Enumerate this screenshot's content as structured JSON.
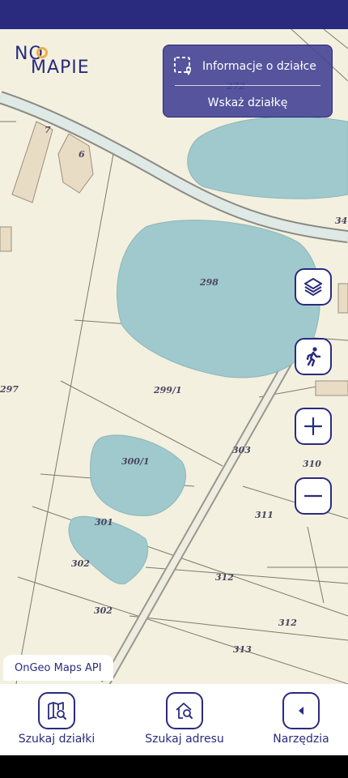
{
  "brand": {
    "logo_top": "NO",
    "logo_bottom": "MAPIE"
  },
  "info_panel": {
    "info_label": "Informacje o działce",
    "point_label": "Wskaż działkę"
  },
  "map": {
    "attribution": "OnGeo Maps API",
    "parcel_labels": [
      "272",
      "7",
      "6",
      "34",
      "298",
      "297",
      "299/1",
      "300/1",
      "303",
      "310",
      "311",
      "301",
      "302",
      "312",
      "302",
      "312",
      "313"
    ]
  },
  "map_controls": [
    "layers-icon",
    "pedestrian-icon",
    "zoom-in-icon",
    "zoom-out-icon"
  ],
  "bottom_nav": {
    "items": [
      {
        "label": "Szukaj działki",
        "icon": "map-search-icon"
      },
      {
        "label": "Szukaj adresu",
        "icon": "house-search-icon"
      },
      {
        "label": "Narzędzia",
        "icon": "chevron-left-icon"
      }
    ]
  },
  "colors": {
    "brand": "#2a2b7e",
    "accent": "#e9b04d",
    "map_bg": "#f3f0df",
    "water": "#9fc9cc"
  }
}
